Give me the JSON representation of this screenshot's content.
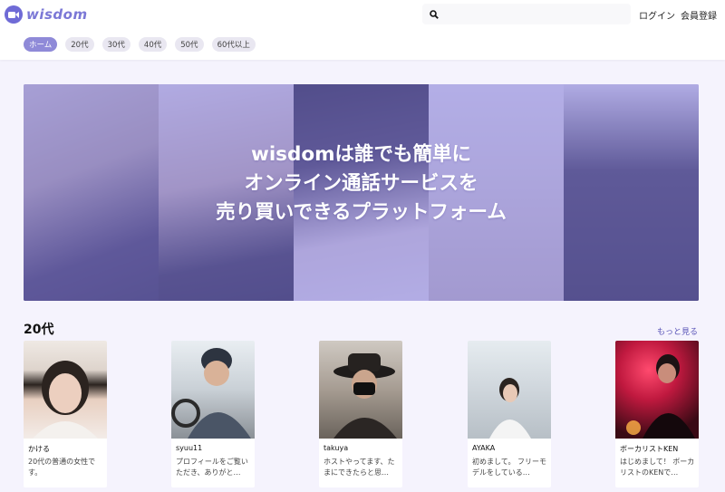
{
  "header": {
    "logo_text": "wisdom",
    "search_placeholder": "",
    "login_label": "ログイン",
    "register_label": "会員登録"
  },
  "tabs": [
    {
      "label": "ホーム",
      "active": true
    },
    {
      "label": "20代",
      "active": false
    },
    {
      "label": "30代",
      "active": false
    },
    {
      "label": "40代",
      "active": false
    },
    {
      "label": "50代",
      "active": false
    },
    {
      "label": "60代以上",
      "active": false
    }
  ],
  "hero": {
    "line1": "wisdomは誰でも簡単に",
    "line2": "オンライン通話サービスを",
    "line3": "売り買いできるプラットフォーム"
  },
  "section": {
    "title": "20代",
    "more_label": "もっと見る"
  },
  "cards": [
    {
      "name": "かける",
      "desc": "20代の普通の女性です。"
    },
    {
      "name": "syuu11",
      "desc": "プロフィールをご覧いただき、ありがと…"
    },
    {
      "name": "takuya",
      "desc": "ホストやってます、たまにできたらと思…"
    },
    {
      "name": "AYAKA",
      "desc": "初めまして。 フリーモデルをしている…"
    },
    {
      "name": "ボーカリストKEN",
      "desc": "はじめまして！ ボーカリストのKENで…"
    }
  ],
  "colors": {
    "accent": "#8f8ad8",
    "logo": "#6f6bd6",
    "hero_overlay": "#7d78e1"
  }
}
